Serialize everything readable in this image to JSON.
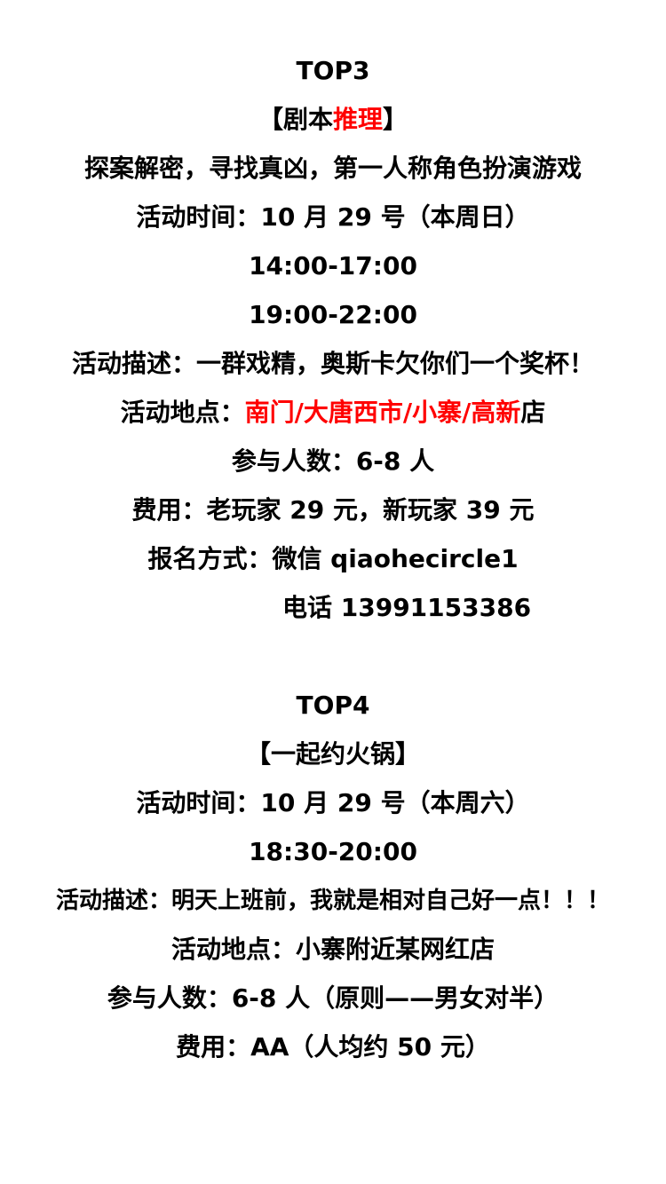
{
  "colors": {
    "text": "#000000",
    "accent": "#ff0000",
    "background": "#ffffff"
  },
  "top3": {
    "heading": "TOP3",
    "title_open": "【剧本",
    "title_red": "推理",
    "title_close": "】",
    "tagline": "探案解密，寻找真凶，第一人称角色扮演游戏",
    "time_label": "活动时间：10 月 29 号（本周日）",
    "time_slot_1": "14:00-17:00",
    "time_slot_2": "19:00-22:00",
    "description": "活动描述：一群戏精，奥斯卡欠你们一个奖杯！",
    "location_prefix": "活动地点：",
    "location_red": "南门/大唐西市/小寨/高新",
    "location_suffix": "店",
    "participants": "参与人数：6-8 人",
    "fee": "费用：老玩家 29 元，新玩家 39 元",
    "signup": "报名方式：微信 qiaohecircle1",
    "phone": "电话 13991153386"
  },
  "top4": {
    "heading": "TOP4",
    "title": "【一起约火锅】",
    "time_label": "活动时间：10 月 29 号（本周六）",
    "time_slot": "18:30-20:00",
    "description": "活动描述：明天上班前，我就是相对自己好一点！！！",
    "location": "活动地点：小寨附近某网红店",
    "participants": "参与人数：6-8 人（原则——男女对半）",
    "fee": "费用：AA（人均约 50 元）"
  }
}
